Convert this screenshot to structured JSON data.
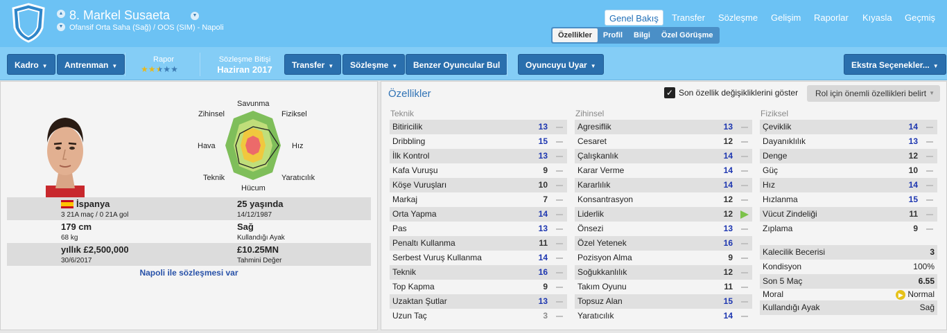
{
  "header": {
    "player_name": "8. Markel Susaeta",
    "subtitle": "Ofansif Orta Saha (Sağ) / OOS (SIM) - Napoli",
    "nav_tabs": [
      "Genel Bakış",
      "Transfer",
      "Sözleşme",
      "Gelişim",
      "Raporlar",
      "Kıyasla",
      "Geçmiş"
    ],
    "sub_tabs": [
      "Özellikler",
      "Profil",
      "Bilgi",
      "Özel Görüşme"
    ]
  },
  "toolbar": {
    "squad": "Kadro",
    "training": "Antrenman",
    "report_label": "Rapor",
    "report_stars": 2.5,
    "contract_end_label": "Sözleşme Bitişi",
    "contract_end_value": "Haziran 2017",
    "transfer": "Transfer",
    "contract": "Sözleşme",
    "similar": "Benzer Oyuncular Bul",
    "warn": "Oyuncuyu Uyar",
    "extra": "Ekstra Seçenekler..."
  },
  "radar_labels": {
    "top": "Savunma",
    "top_left": "Zihinsel",
    "top_right": "Fiziksel",
    "left": "Hava",
    "right": "Hız",
    "bottom_left": "Teknik",
    "bottom_right": "Yaratıcılık",
    "bottom": "Hücum"
  },
  "info": {
    "nationality": "İspanya",
    "caps": "3 21A maç / 0 21A gol",
    "age": "25 yaşında",
    "dob": "14/12/1987",
    "height": "179 cm",
    "weight": "68 kg",
    "foot": "Sağ",
    "foot_label": "Kullandığı Ayak",
    "wage": "yıllık £2,500,000",
    "contract_date": "30/6/2017",
    "value": "£10.25MN",
    "value_label": "Tahmini Değer",
    "contract_note": "Napoli ile sözleşmesi var"
  },
  "attributes_panel": {
    "title": "Özellikler",
    "show_changes_label": "Son özellik değişikliklerini göster",
    "role_button": "Rol için önemli özellikleri belirt"
  },
  "technical": {
    "title": "Teknik",
    "items": [
      {
        "name": "Bitiricilik",
        "value": "13"
      },
      {
        "name": "Dribbling",
        "value": "15"
      },
      {
        "name": "İlk Kontrol",
        "value": "13"
      },
      {
        "name": "Kafa Vuruşu",
        "value": "9"
      },
      {
        "name": "Köşe Vuruşları",
        "value": "10"
      },
      {
        "name": "Markaj",
        "value": "7"
      },
      {
        "name": "Orta Yapma",
        "value": "14"
      },
      {
        "name": "Pas",
        "value": "13"
      },
      {
        "name": "Penaltı Kullanma",
        "value": "11"
      },
      {
        "name": "Serbest Vuruş Kullanma",
        "value": "14"
      },
      {
        "name": "Teknik",
        "value": "16"
      },
      {
        "name": "Top Kapma",
        "value": "9"
      },
      {
        "name": "Uzaktan Şutlar",
        "value": "13"
      },
      {
        "name": "Uzun Taç",
        "value": "3"
      }
    ]
  },
  "mental": {
    "title": "Zihinsel",
    "items": [
      {
        "name": "Agresiflik",
        "value": "13"
      },
      {
        "name": "Cesaret",
        "value": "12"
      },
      {
        "name": "Çalışkanlık",
        "value": "14"
      },
      {
        "name": "Karar Verme",
        "value": "14"
      },
      {
        "name": "Kararlılık",
        "value": "14"
      },
      {
        "name": "Konsantrasyon",
        "value": "12"
      },
      {
        "name": "Liderlik",
        "value": "12"
      },
      {
        "name": "Önsezi",
        "value": "13"
      },
      {
        "name": "Özel Yetenek",
        "value": "16"
      },
      {
        "name": "Pozisyon Alma",
        "value": "9"
      },
      {
        "name": "Soğukkanlılık",
        "value": "12"
      },
      {
        "name": "Takım Oyunu",
        "value": "11"
      },
      {
        "name": "Topsuz Alan",
        "value": "15"
      },
      {
        "name": "Yaratıcılık",
        "value": "14"
      }
    ]
  },
  "physical": {
    "title": "Fiziksel",
    "items": [
      {
        "name": "Çeviklik",
        "value": "14"
      },
      {
        "name": "Dayanıklılık",
        "value": "13"
      },
      {
        "name": "Denge",
        "value": "12"
      },
      {
        "name": "Güç",
        "value": "10"
      },
      {
        "name": "Hız",
        "value": "14"
      },
      {
        "name": "Hızlanma",
        "value": "15"
      },
      {
        "name": "Vücut Zindeliği",
        "value": "11"
      },
      {
        "name": "Zıplama",
        "value": "9"
      }
    ]
  },
  "stats": [
    {
      "name": "Kalecilik Becerisi",
      "value": "3"
    },
    {
      "name": "Kondisyon",
      "value": "100%"
    },
    {
      "name": "Son 5 Maç",
      "value": "6.55"
    },
    {
      "name": "Moral",
      "value": "Normal"
    },
    {
      "name": "Kullandığı Ayak",
      "value": "Sağ"
    }
  ],
  "colors": {
    "header_bg": "#6cc2f4",
    "button_bg": "#2a6fad",
    "value_blue": "#1d36b0",
    "improve_arrow": "#7cc24a"
  }
}
